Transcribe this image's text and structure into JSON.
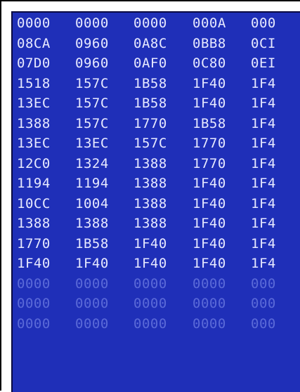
{
  "colors": {
    "panel_background": "#1f2fb8",
    "text_normal": "#e7e9ff",
    "text_dim": "#5b6ad8",
    "frame_border": "#000000"
  },
  "hex_view": {
    "rows": [
      {
        "dim": false,
        "cells": [
          "0000",
          "0000",
          "0000",
          "000A",
          "000"
        ]
      },
      {
        "dim": false,
        "cells": [
          "08CA",
          "0960",
          "0A8C",
          "0BB8",
          "0CI"
        ]
      },
      {
        "dim": false,
        "cells": [
          "07D0",
          "0960",
          "0AF0",
          "0C80",
          "0EI"
        ]
      },
      {
        "dim": false,
        "cells": [
          "1518",
          "157C",
          "1B58",
          "1F40",
          "1F4"
        ]
      },
      {
        "dim": false,
        "cells": [
          "13EC",
          "157C",
          "1B58",
          "1F40",
          "1F4"
        ]
      },
      {
        "dim": false,
        "cells": [
          "1388",
          "157C",
          "1770",
          "1B58",
          "1F4"
        ]
      },
      {
        "dim": false,
        "cells": [
          "13EC",
          "13EC",
          "157C",
          "1770",
          "1F4"
        ]
      },
      {
        "dim": false,
        "cells": [
          "12C0",
          "1324",
          "1388",
          "1770",
          "1F4"
        ]
      },
      {
        "dim": false,
        "cells": [
          "1194",
          "1194",
          "1388",
          "1F40",
          "1F4"
        ]
      },
      {
        "dim": false,
        "cells": [
          "10CC",
          "1004",
          "1388",
          "1F40",
          "1F4"
        ]
      },
      {
        "dim": false,
        "cells": [
          "1388",
          "1388",
          "1388",
          "1F40",
          "1F4"
        ]
      },
      {
        "dim": false,
        "cells": [
          "1770",
          "1B58",
          "1F40",
          "1F40",
          "1F4"
        ]
      },
      {
        "dim": false,
        "cells": [
          "1F40",
          "1F40",
          "1F40",
          "1F40",
          "1F4"
        ]
      },
      {
        "dim": true,
        "cells": [
          "0000",
          "0000",
          "0000",
          "0000",
          "000"
        ]
      },
      {
        "dim": true,
        "cells": [
          "0000",
          "0000",
          "0000",
          "0000",
          "000"
        ]
      },
      {
        "dim": true,
        "cells": [
          "0000",
          "0000",
          "0000",
          "0000",
          "000"
        ]
      }
    ]
  }
}
